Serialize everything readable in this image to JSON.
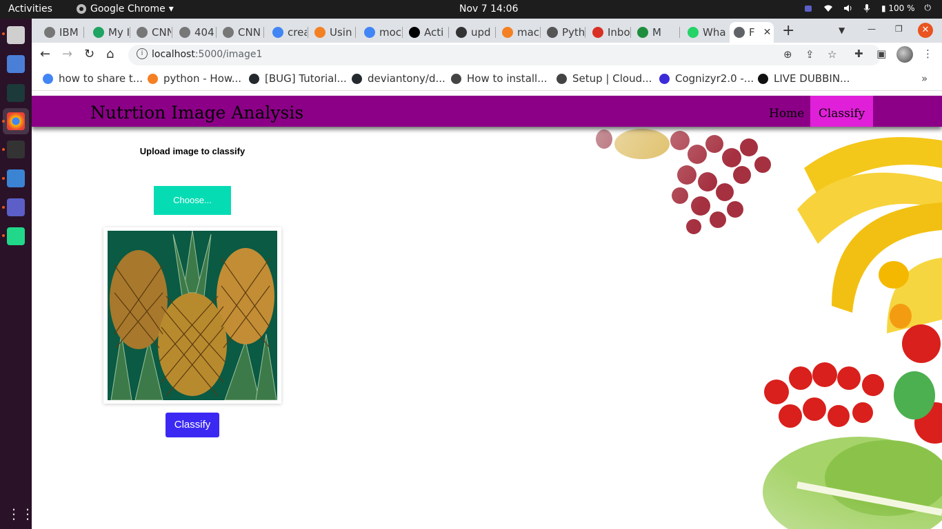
{
  "os": {
    "activities": "Activities",
    "app_name": "Google Chrome",
    "clock": "Nov 7  14:06",
    "battery": "100 %"
  },
  "browser": {
    "tabs": [
      {
        "label": "IBM",
        "fav_color": "#777777"
      },
      {
        "label": "My I",
        "fav_color": "#1fa463"
      },
      {
        "label": "CNN",
        "fav_color": "#777777"
      },
      {
        "label": "404",
        "fav_color": "#777777"
      },
      {
        "label": "CNN",
        "fav_color": "#777777"
      },
      {
        "label": "crea",
        "fav_color": "#4285f4"
      },
      {
        "label": "Usin",
        "fav_color": "#f48024"
      },
      {
        "label": "moc",
        "fav_color": "#4285f4"
      },
      {
        "label": "Acti",
        "fav_color": "#000000"
      },
      {
        "label": "upd",
        "fav_color": "#333333"
      },
      {
        "label": "mac",
        "fav_color": "#f48024"
      },
      {
        "label": "Pyth",
        "fav_color": "#555555"
      },
      {
        "label": "Inbo",
        "fav_color": "#d93025"
      },
      {
        "label": "M",
        "fav_color": "#1e8e3e"
      },
      {
        "label": "Wha",
        "fav_color": "#25d366"
      },
      {
        "label": "F",
        "fav_color": "#5f6368",
        "active": true
      }
    ],
    "address": {
      "host": "localhost",
      "path": ":5000/image1"
    },
    "bookmarks": [
      {
        "label": "how to share t...",
        "color": "#4285f4"
      },
      {
        "label": "python - How...",
        "color": "#f48024"
      },
      {
        "label": "[BUG] Tutorial...",
        "color": "#24292e"
      },
      {
        "label": "deviantony/d...",
        "color": "#24292e"
      },
      {
        "label": "How to install...",
        "color": "#444444"
      },
      {
        "label": "Setup | Cloud...",
        "color": "#444444"
      },
      {
        "label": "Cognizyr2.0 -...",
        "color": "#3b2bd9"
      },
      {
        "label": "LIVE DUBBIN...",
        "color": "#111111"
      }
    ]
  },
  "site": {
    "title": "Nutrtion Image Analysis",
    "nav": {
      "home": "Home",
      "classify": "Classify"
    },
    "upload_label": "Upload image to classify",
    "choose_label": "Choose...",
    "classify_label": "Classify",
    "colors": {
      "nav_bg": "#8b0087",
      "active_tab": "#e020d8",
      "choose_bg": "#06dcb4",
      "classify_bg": "#3b29f3"
    }
  }
}
